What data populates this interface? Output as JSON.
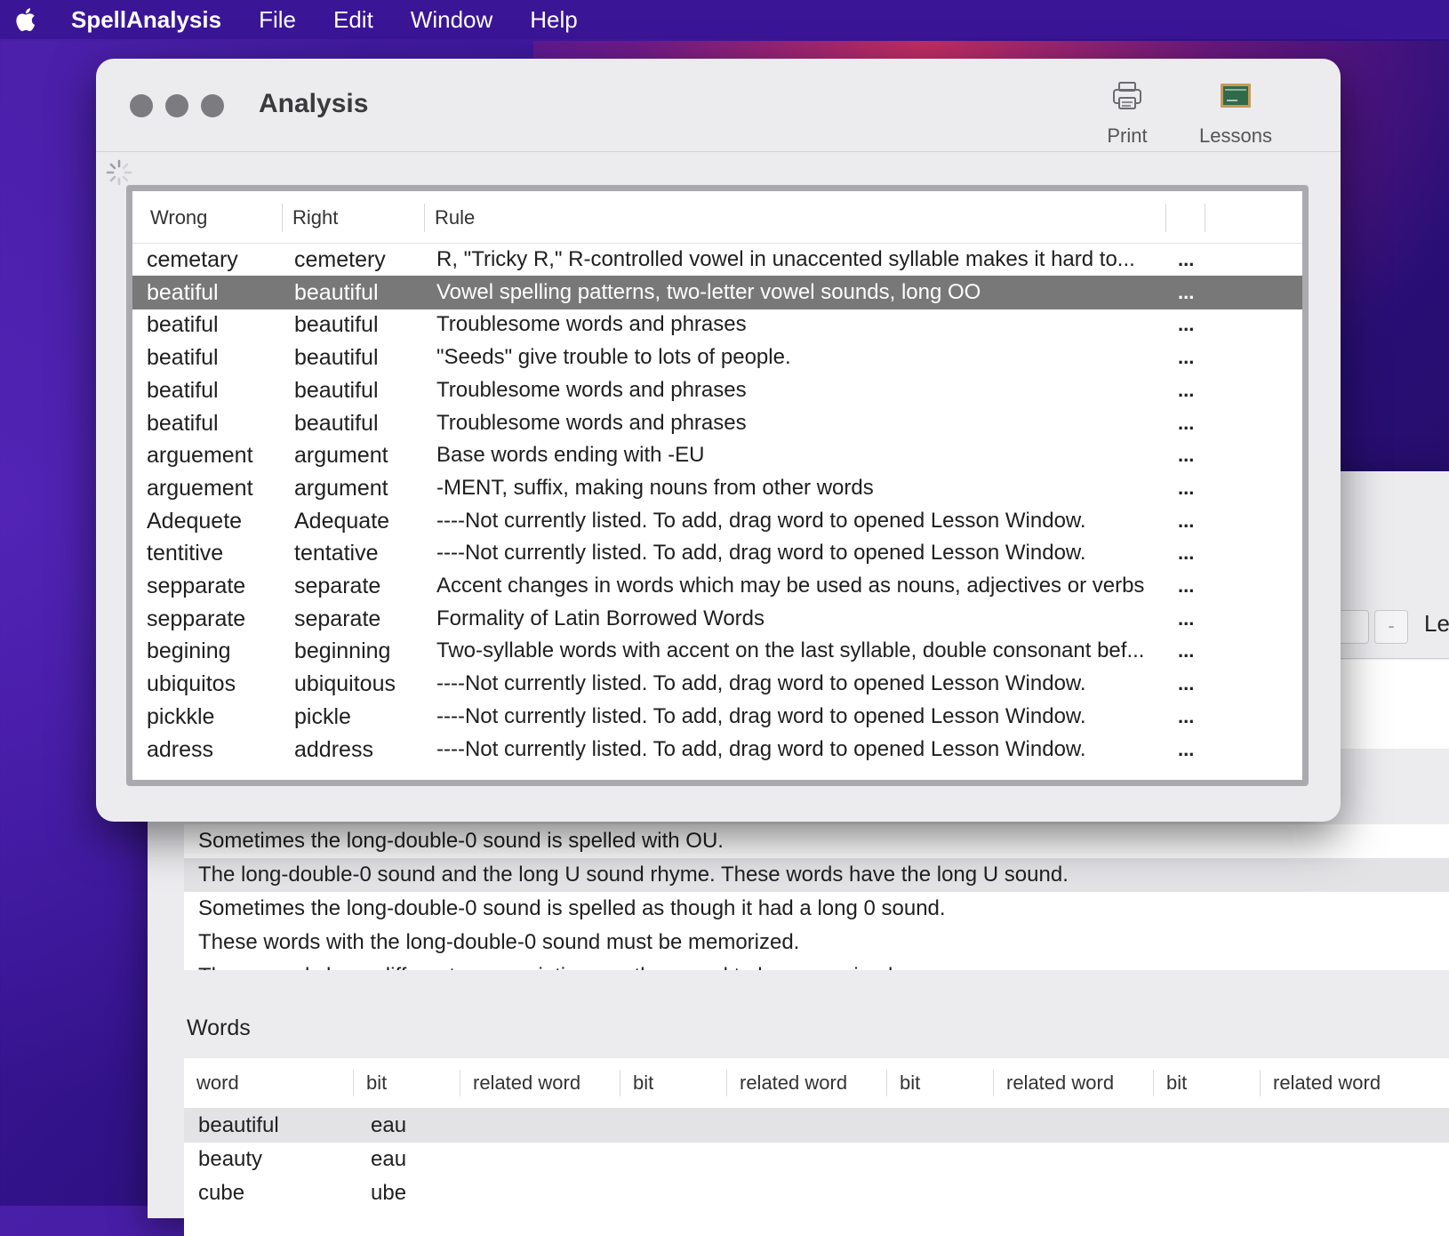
{
  "menubar": {
    "app_name": "SpellAnalysis",
    "items": [
      "File",
      "Edit",
      "Window",
      "Help"
    ]
  },
  "window": {
    "title": "Analysis",
    "toolbar": {
      "print_label": "Print",
      "lessons_label": "Lessons"
    }
  },
  "table": {
    "columns": [
      "Wrong",
      "Right",
      "Rule"
    ],
    "selected_index": 1,
    "rows": [
      {
        "wrong": "cemetary",
        "right": "cemetery",
        "rule": "R, \"Tricky R,\" R-controlled vowel in unaccented syllable makes it hard to...",
        "more": "..."
      },
      {
        "wrong": "beatiful",
        "right": "beautiful",
        "rule": "Vowel spelling patterns, two-letter vowel sounds, long OO",
        "more": "..."
      },
      {
        "wrong": "beatiful",
        "right": "beautiful",
        "rule": "Troublesome words and phrases",
        "more": "..."
      },
      {
        "wrong": "beatiful",
        "right": "beautiful",
        "rule": "\"Seeds\" give trouble to lots of people.",
        "more": "..."
      },
      {
        "wrong": "beatiful",
        "right": "beautiful",
        "rule": "Troublesome words and phrases",
        "more": "..."
      },
      {
        "wrong": "beatiful",
        "right": "beautiful",
        "rule": "Troublesome words and phrases",
        "more": "..."
      },
      {
        "wrong": "arguement",
        "right": "argument",
        "rule": "Base words ending with -EU",
        "more": "..."
      },
      {
        "wrong": "arguement",
        "right": "argument",
        "rule": "-MENT, suffix, making nouns from other words",
        "more": "..."
      },
      {
        "wrong": "Adequete",
        "right": "Adequate",
        "rule": "----Not currently listed. To add, drag word to opened Lesson Window.",
        "more": "..."
      },
      {
        "wrong": "tentitive",
        "right": "tentative",
        "rule": "----Not currently listed. To add, drag word to opened Lesson Window.",
        "more": "..."
      },
      {
        "wrong": "sepparate",
        "right": "separate",
        "rule": "Accent changes in words which may be used as nouns, adjectives or verbs",
        "more": "..."
      },
      {
        "wrong": "sepparate",
        "right": "separate",
        "rule": "Formality of Latin Borrowed Words",
        "more": "..."
      },
      {
        "wrong": "begining",
        "right": "beginning",
        "rule": "Two-syllable words with accent on the last syllable, double consonant bef...",
        "more": "..."
      },
      {
        "wrong": "ubiquitos",
        "right": "ubiquitous",
        "rule": "----Not currently listed. To add, drag word to opened Lesson Window.",
        "more": "..."
      },
      {
        "wrong": "pickkle",
        "right": "pickle",
        "rule": "----Not currently listed. To add, drag word to opened Lesson Window.",
        "more": "..."
      },
      {
        "wrong": "adress",
        "right": "address",
        "rule": "----Not currently listed. To add, drag word to opened Lesson Window.",
        "more": "..."
      }
    ]
  },
  "lesson_window": {
    "toolbar_button_minus": "-",
    "title_fragment": "Les",
    "rules": [
      "Sometimes the long-double-0 sound is spelled with OU.",
      "The long-double-0 sound and the long U sound rhyme. These words have the long U sound.",
      "Sometimes the long-double-0 sound is spelled as though it had a long 0 sound.",
      "These words with the long-double-0 sound must be memorized.",
      "These words have different pronunciations so they need to be memorized."
    ],
    "selected_rule_index": 1,
    "words_label": "Words",
    "words_columns": [
      "word",
      "bit",
      "related word",
      "bit",
      "related word",
      "bit",
      "related word",
      "bit",
      "related word"
    ],
    "words_rows": [
      {
        "word": "beautiful",
        "bit": "eau"
      },
      {
        "word": "beauty",
        "bit": "eau"
      },
      {
        "word": "cube",
        "bit": "ube"
      }
    ]
  }
}
